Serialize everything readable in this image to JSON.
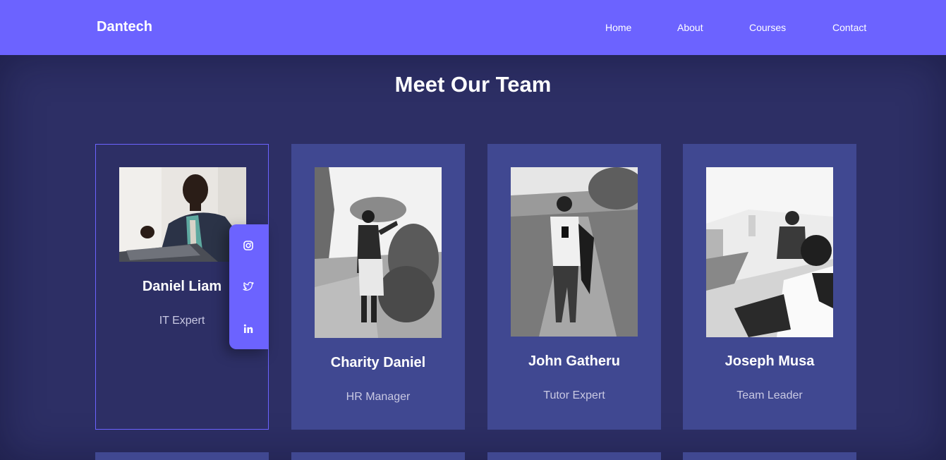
{
  "nav": {
    "brand": "Dantech",
    "links": [
      "Home",
      "About",
      "Courses",
      "Contact"
    ]
  },
  "section": {
    "title": "Meet Our Team"
  },
  "team": [
    {
      "name": "Daniel Liam",
      "role": "IT Expert"
    },
    {
      "name": "Charity Daniel",
      "role": "HR Manager"
    },
    {
      "name": "John Gatheru",
      "role": "Tutor Expert"
    },
    {
      "name": "Joseph Musa",
      "role": "Team Leader"
    }
  ],
  "social_icons": [
    "instagram-icon",
    "twitter-icon",
    "linkedin-icon"
  ],
  "colors": {
    "accent": "#6c63ff",
    "background": "#2d2f65",
    "card": "#404891",
    "role_text": "#c9c9e3"
  }
}
